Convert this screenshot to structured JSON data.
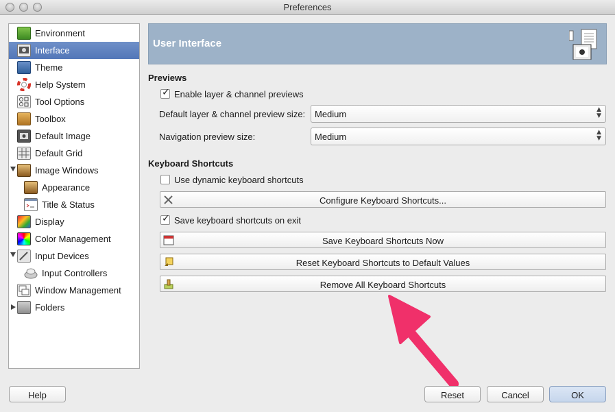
{
  "window": {
    "title": "Preferences"
  },
  "sidebar": {
    "items": [
      {
        "label": "Environment",
        "icon": "environment-icon"
      },
      {
        "label": "Interface",
        "icon": "interface-icon",
        "selected": true
      },
      {
        "label": "Theme",
        "icon": "theme-icon"
      },
      {
        "label": "Help System",
        "icon": "help-system-icon"
      },
      {
        "label": "Tool Options",
        "icon": "tool-options-icon"
      },
      {
        "label": "Toolbox",
        "icon": "toolbox-icon"
      },
      {
        "label": "Default Image",
        "icon": "default-image-icon"
      },
      {
        "label": "Default Grid",
        "icon": "default-grid-icon"
      },
      {
        "label": "Image Windows",
        "icon": "image-windows-icon",
        "expander": "open"
      },
      {
        "label": "Appearance",
        "icon": "appearance-icon",
        "indent": true
      },
      {
        "label": "Title & Status",
        "icon": "title-status-icon",
        "indent": true
      },
      {
        "label": "Display",
        "icon": "display-icon"
      },
      {
        "label": "Color Management",
        "icon": "color-management-icon"
      },
      {
        "label": "Input Devices",
        "icon": "input-devices-icon",
        "expander": "open"
      },
      {
        "label": "Input Controllers",
        "icon": "input-controllers-icon",
        "indent": true
      },
      {
        "label": "Window Management",
        "icon": "window-management-icon"
      },
      {
        "label": "Folders",
        "icon": "folders-icon",
        "expander": "closed"
      }
    ]
  },
  "header": {
    "title": "User Interface"
  },
  "previews": {
    "section_title": "Previews",
    "enable_previews": {
      "label": "Enable layer & channel previews",
      "checked": true
    },
    "preview_size": {
      "label": "Default layer & channel preview size:",
      "value": "Medium"
    },
    "nav_preview_size": {
      "label": "Navigation preview size:",
      "value": "Medium"
    }
  },
  "shortcuts": {
    "section_title": "Keyboard Shortcuts",
    "dynamic": {
      "label": "Use dynamic keyboard shortcuts",
      "checked": false
    },
    "configure_label": "Configure Keyboard Shortcuts...",
    "save_on_exit": {
      "label": "Save keyboard shortcuts on exit",
      "checked": true
    },
    "save_now_label": "Save Keyboard Shortcuts Now",
    "reset_label": "Reset Keyboard Shortcuts to Default Values",
    "remove_label": "Remove All Keyboard Shortcuts"
  },
  "footer": {
    "help_label": "Help",
    "reset_label": "Reset",
    "cancel_label": "Cancel",
    "ok_label": "OK"
  },
  "colors": {
    "selection": "#5a7fbe",
    "banner": "#9db2c8",
    "annotation_arrow": "#f0306a"
  }
}
